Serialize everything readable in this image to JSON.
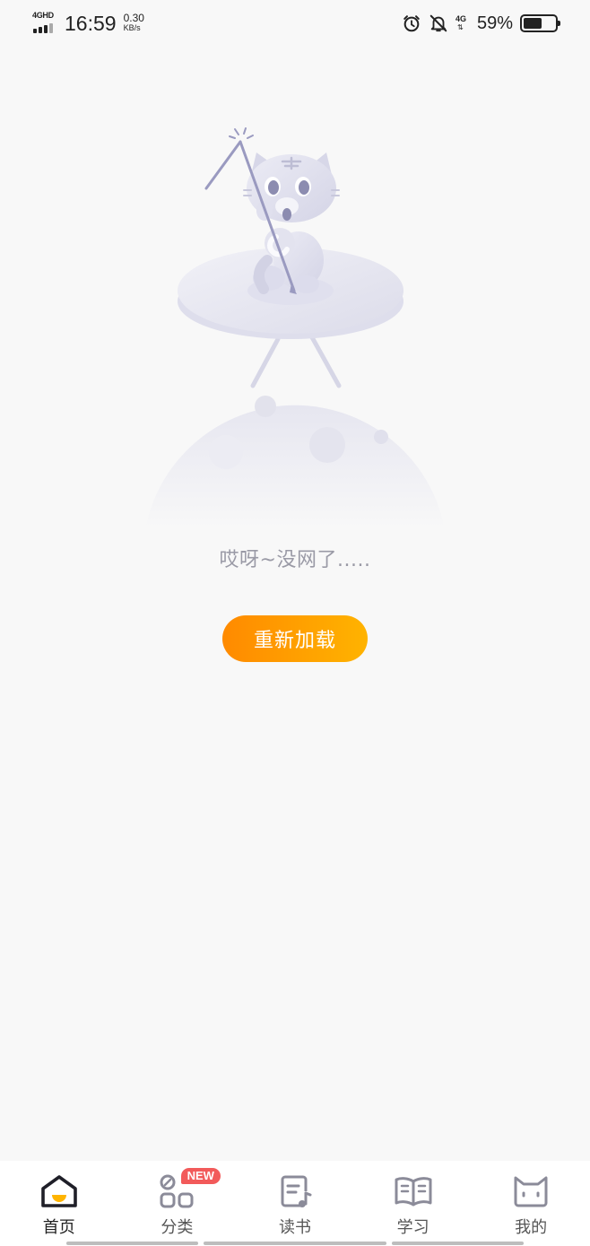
{
  "status_bar": {
    "network_type": "4GHD",
    "time": "16:59",
    "speed_value": "0.30",
    "speed_unit": "KB/s",
    "network_type_2": "4G",
    "battery_percent": "59%",
    "battery_level": 0.59
  },
  "empty_state": {
    "message": "哎呀~没网了.....",
    "reload_label": "重新加载"
  },
  "colors": {
    "accent_start": "#ff8a00",
    "accent_end": "#ffb300",
    "badge": "#f25a5a",
    "illustration": "#c9c9df"
  },
  "bottom_nav": {
    "items": [
      {
        "label": "首页",
        "icon": "home-icon",
        "active": true
      },
      {
        "label": "分类",
        "icon": "category-icon",
        "badge": "NEW"
      },
      {
        "label": "读书",
        "icon": "book-audio-icon"
      },
      {
        "label": "学习",
        "icon": "open-book-icon"
      },
      {
        "label": "我的",
        "icon": "cat-face-icon"
      }
    ]
  }
}
